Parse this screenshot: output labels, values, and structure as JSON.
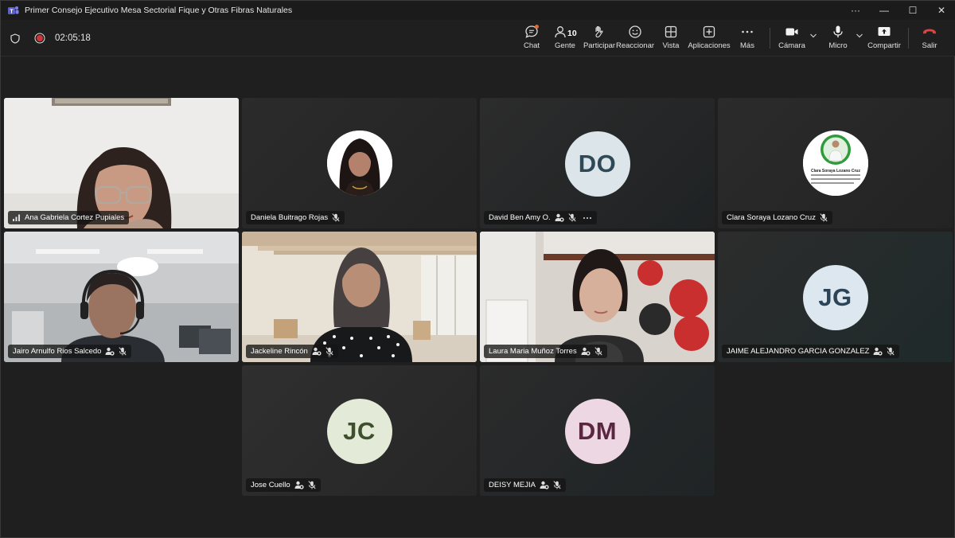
{
  "window": {
    "title": "Primer Consejo Ejecutivo Mesa Sectorial Fique y Otras Fibras Naturales",
    "controls": [
      "···",
      "—",
      "☐",
      "✕"
    ]
  },
  "meeting": {
    "elapsed": "02:05:18",
    "people_count": "10"
  },
  "toolbar": {
    "chat": "Chat",
    "people": "Gente",
    "raise": "Participar",
    "react": "Reaccionar",
    "view": "Vista",
    "apps": "Aplicaciones",
    "more": "Más",
    "camera": "Cámara",
    "mic": "Micro",
    "share": "Compartir",
    "leave": "Salir"
  },
  "colors": {
    "leave_red": "#e0433d",
    "chat_badge": "#e06a3a",
    "avatar_do": "#dce6ea",
    "avatar_jg": "#dde7ef",
    "avatar_jc": "#e3ead8",
    "avatar_dm": "#ecd7e2"
  },
  "participants": [
    {
      "name": "Ana Gabriela Cortez Pupiales",
      "type": "video"
    },
    {
      "name": "Daniela Buitrago Rojas",
      "type": "photo"
    },
    {
      "name": "David Ben Amy O.",
      "type": "initials",
      "initials": "DO"
    },
    {
      "name": "Clara Soraya Lozano Cruz",
      "type": "photo",
      "photo_caption": "Clara Soraya Lozano Cruz"
    },
    {
      "name": "Jairo Arnulfo Rios Salcedo",
      "type": "video"
    },
    {
      "name": "Jackeline Rincón",
      "type": "video"
    },
    {
      "name": "Laura Maria Muñoz Torres",
      "type": "video"
    },
    {
      "name": "JAIME ALEJANDRO GARCIA GONZALEZ",
      "type": "initials",
      "initials": "JG"
    },
    {
      "name": "Jose Cuello",
      "type": "initials",
      "initials": "JC"
    },
    {
      "name": "DEISY MEJIA",
      "type": "initials",
      "initials": "DM"
    }
  ]
}
